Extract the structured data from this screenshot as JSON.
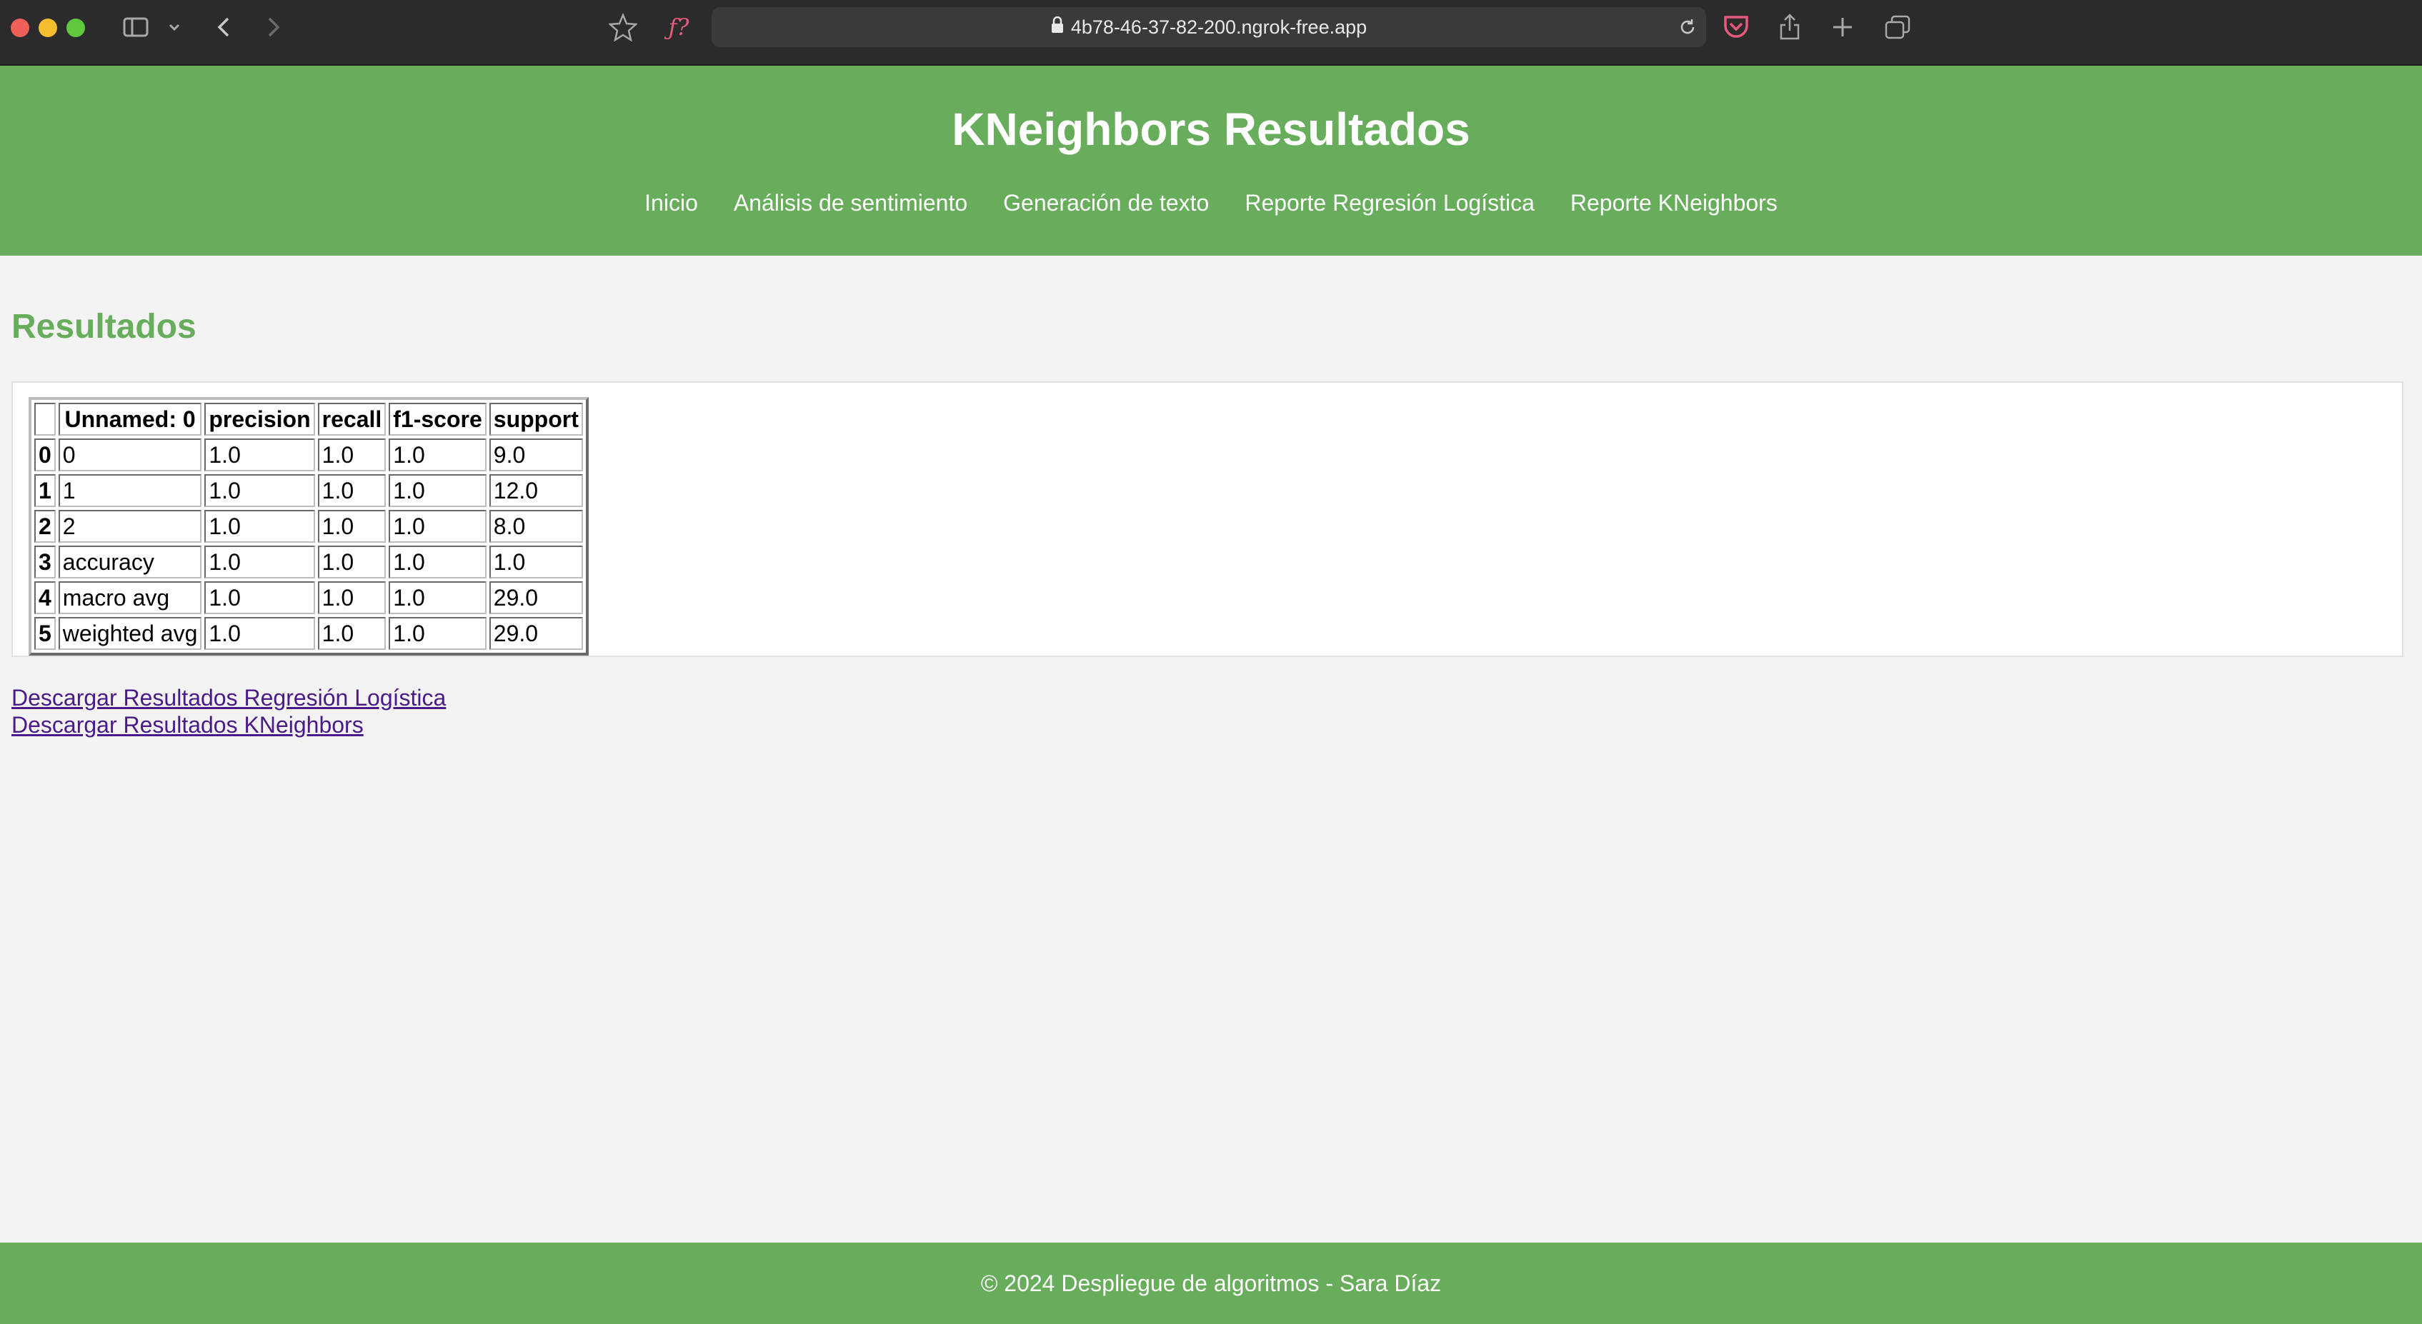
{
  "browser": {
    "url": "4b78-46-37-82-200.ngrok-free.app"
  },
  "header": {
    "title": "KNeighbors Resultados",
    "nav": [
      "Inicio",
      "Análisis de sentimiento",
      "Generación de texto",
      "Reporte Regresión Logística",
      "Reporte KNeighbors"
    ]
  },
  "main": {
    "section_title": "Resultados",
    "table": {
      "columns": [
        "",
        "Unnamed: 0",
        "precision",
        "recall",
        "f1-score",
        "support"
      ],
      "rows": [
        [
          "0",
          "0",
          "1.0",
          "1.0",
          "1.0",
          "9.0"
        ],
        [
          "1",
          "1",
          "1.0",
          "1.0",
          "1.0",
          "12.0"
        ],
        [
          "2",
          "2",
          "1.0",
          "1.0",
          "1.0",
          "8.0"
        ],
        [
          "3",
          "accuracy",
          "1.0",
          "1.0",
          "1.0",
          "1.0"
        ],
        [
          "4",
          "macro avg",
          "1.0",
          "1.0",
          "1.0",
          "29.0"
        ],
        [
          "5",
          "weighted avg",
          "1.0",
          "1.0",
          "1.0",
          "29.0"
        ]
      ]
    },
    "links": [
      "Descargar Resultados Regresión Logística",
      "Descargar Resultados KNeighbors"
    ]
  },
  "footer": {
    "text": "© 2024 Despliegue de algoritmos - Sara Díaz"
  },
  "colors": {
    "brand": "#68ad5c",
    "background": "#f3f3f3",
    "visited_link": "#4a1a8a"
  }
}
